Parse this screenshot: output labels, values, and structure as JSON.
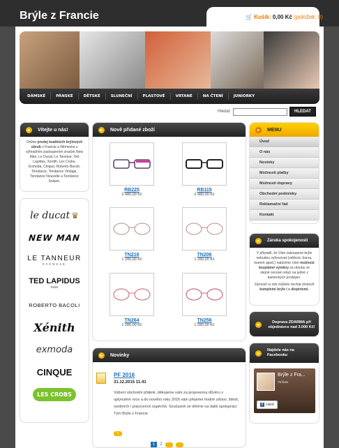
{
  "header": {
    "site_title": "Brýle z Francie",
    "cart_label": "Košík:",
    "cart_value": "0,00 Kč",
    "cart_count": "(položek: 0)"
  },
  "nav": [
    "DÁMSKÉ",
    "PÁNSKÉ",
    "DĚTSKÉ",
    "SLUNEČNÍ",
    "PLASTOVÉ",
    "VRTANÉ",
    "NA ČTENÍ",
    "JUNIORKY"
  ],
  "search": {
    "label": "Hledat:",
    "button": "HLEDAT",
    "value": ""
  },
  "welcome": {
    "title": "Vítejte u nás!",
    "text_1": "Online ",
    "text_bold": "prodej kvalitních brýlových obrub",
    "text_2": " z Francie a Německa s výhradním zastoupením značek New Man, Le Ducat, Le Tanneur, Ted Lapidus, Xenith, Les Crobs, Exmoda, Cinque, Roberto Bacoli, Tendance, Tendance Vintage, Tendance Nouvelle a Tendance Solaire."
  },
  "brands": [
    "le ducat",
    "NEW MAN",
    "LE TANNEUR",
    "EYEWEAR",
    "TED LAPIDUS",
    "PARIS",
    "ROBERTO BACOLI",
    "Xénith",
    "exmoda",
    "CINQUE",
    "LES CROBS"
  ],
  "new_products": {
    "title": "Nově přidané zboží",
    "items": [
      {
        "name": "RB225",
        "price": "2 480,00 Kč"
      },
      {
        "name": "RB115",
        "price": "2 480,00 Kč"
      },
      {
        "name": "TN216",
        "price": "1 280,00 Kč"
      },
      {
        "name": "TN206",
        "price": "1 280,00 Kč"
      },
      {
        "name": "TN264",
        "price": "1 280,00 Kč"
      },
      {
        "name": "TN256",
        "price": "1 280,00 Kč"
      }
    ]
  },
  "news": {
    "title": "Novinky",
    "item_title": "PF 2016",
    "item_date": "31.12.2015 11:41",
    "item_text": "Vážení obchodní přátelé, děkujeme vám za projevenou důvěru v uplynulém roce a do nového roku 2016 vám přejeme hodně zdraví, štěstí, osobních i pracovních úspěchů. Současně se těšíme na další spolupráci. Tým Brýle z Francie",
    "pages": [
      "1",
      "2"
    ]
  },
  "menu": {
    "title": "MENU",
    "items": [
      "Úvod",
      "O nás",
      "Novinky",
      "Možnosti platby",
      "Možnosti dopravy",
      "Obchodní podmínky",
      "Reklamační řád",
      "Kontakt"
    ]
  },
  "guarantee": {
    "title": "Záruka spokojenosti",
    "text_1": "V případě, že Vám zakoupené brýle nebudou vyhovovat (velikost, barva, tvarem apod.) nabízíme Vám ",
    "text_bold": "možnost bezplatné výměny",
    "text_2": " za obruby ve stejné cenové relaci na jedné z kamenných prodejen.",
    "text_3": "Zároveň si zde můžete nechat zhotovit ",
    "text_bold_2": "kompletní brýle i s dioptriemi."
  },
  "delivery": {
    "text": "Doprava ZDARMA při objednávce nad 3.000 Kč!"
  },
  "facebook": {
    "title": "Najdete nás na Facebooku",
    "page_name": "Brýle z Fra...",
    "likes": "76 likes",
    "like_button": "Liked"
  },
  "colors": {
    "accent": "#f0b800",
    "link": "#1d6fb8",
    "cart_orange": "#e87a00",
    "dark": "#2e2e2e"
  }
}
